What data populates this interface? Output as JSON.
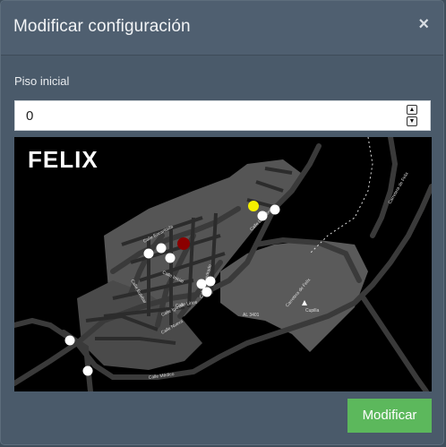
{
  "modal": {
    "title": "Modificar configuración",
    "close_glyph": "×",
    "close_icon": "close-icon"
  },
  "form": {
    "floor_label": "Piso inicial",
    "floor_value": "0",
    "stepper_up": "▲",
    "stepper_down": "▼"
  },
  "map": {
    "title": "FELIX",
    "street_labels": [
      "Calle Encantada",
      "Calle La Palma",
      "Calle Inicial",
      "Calle Bulebar",
      "Calle Iglesia",
      "Calle Lirios",
      "Calle Nueva",
      "Calle Empedrado",
      "Calle Médico",
      "AL 3401",
      "Carretera de Felix",
      "Carretera de Felix",
      "Cupilla"
    ],
    "marker_colors": {
      "white": "#ffffff",
      "yellow": "#f5f000",
      "red": "#8b0000"
    }
  },
  "actions": {
    "submit_label": "Modificar",
    "submit_color": "#5cb85c"
  }
}
